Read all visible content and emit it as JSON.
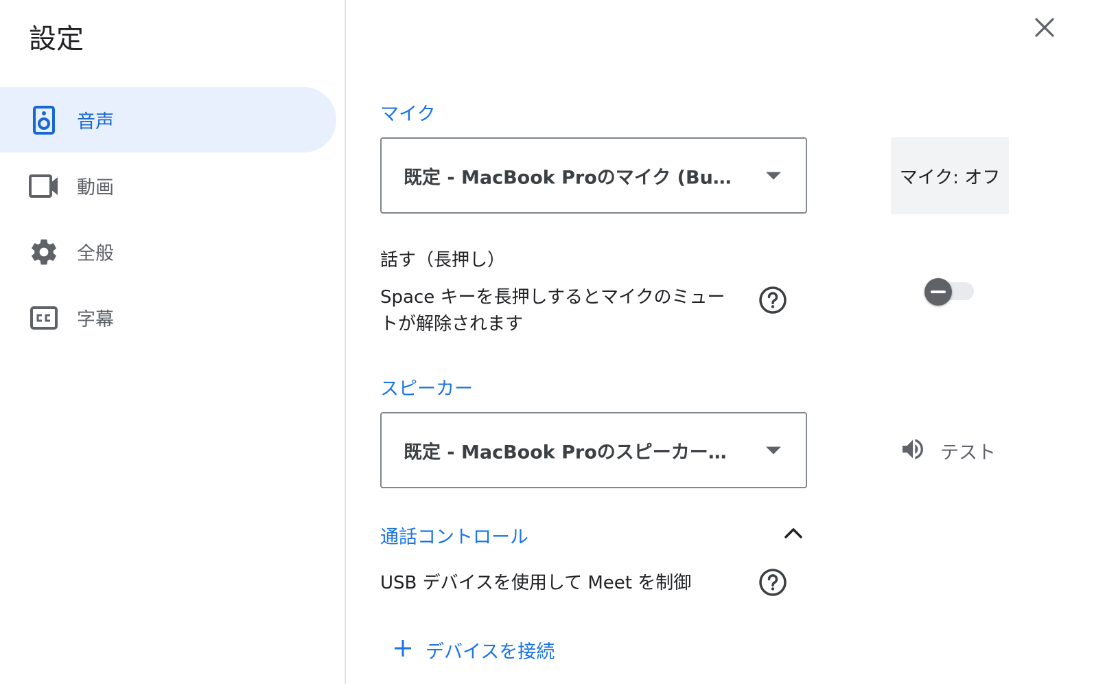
{
  "dialog": {
    "title": "設定",
    "close_icon": "close-icon"
  },
  "sidebar": {
    "items": [
      {
        "label": "音声",
        "icon": "speaker-icon",
        "active": true
      },
      {
        "label": "動画",
        "icon": "video-camera-icon",
        "active": false
      },
      {
        "label": "全般",
        "icon": "gear-icon",
        "active": false
      },
      {
        "label": "字幕",
        "icon": "closed-caption-icon",
        "active": false
      }
    ]
  },
  "microphone": {
    "section_title": "マイク",
    "selected": "既定 - MacBook Proのマイク (Built-in)",
    "status": "マイク: オフ"
  },
  "push_to_talk": {
    "label": "話す（長押し）",
    "description": "Space キーを長押しするとマイクのミュートが解除されます",
    "enabled": false,
    "help_icon": "help-circle-icon"
  },
  "speaker": {
    "section_title": "スピーカー",
    "selected": "既定 - MacBook Proのスピーカー (Bu...",
    "test_label": "テスト",
    "test_icon": "volume-icon"
  },
  "call_control": {
    "section_title": "通話コントロール",
    "expanded": true,
    "usb_label": "USB デバイスを使用して Meet を制御",
    "connect_label": "デバイスを接続",
    "connect_icon": "plus-icon"
  },
  "colors": {
    "accent": "#1a73e8",
    "active_bg": "#e8f0fe",
    "icon_gray": "#5f6368"
  }
}
